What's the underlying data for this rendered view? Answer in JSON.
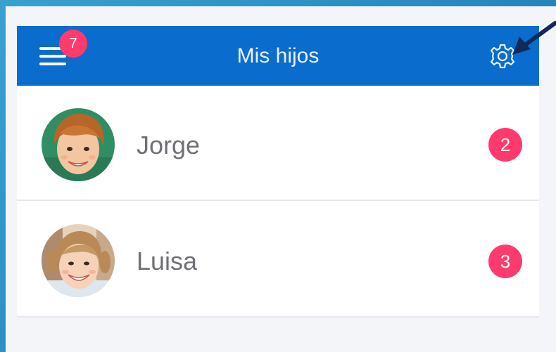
{
  "header": {
    "title": "Mis hijos",
    "menu_badge": "7",
    "menu_icon": "hamburger-menu-icon",
    "settings_icon": "gear-icon",
    "background_color": "#0a6ccd"
  },
  "children": [
    {
      "name": "Jorge",
      "badge": "2"
    },
    {
      "name": "Luisa",
      "badge": "3"
    }
  ],
  "colors": {
    "badge": "#ff3a6d",
    "header": "#0a6ccd",
    "frame": "#2b8fc4",
    "arrow": "#0d2c5c"
  }
}
